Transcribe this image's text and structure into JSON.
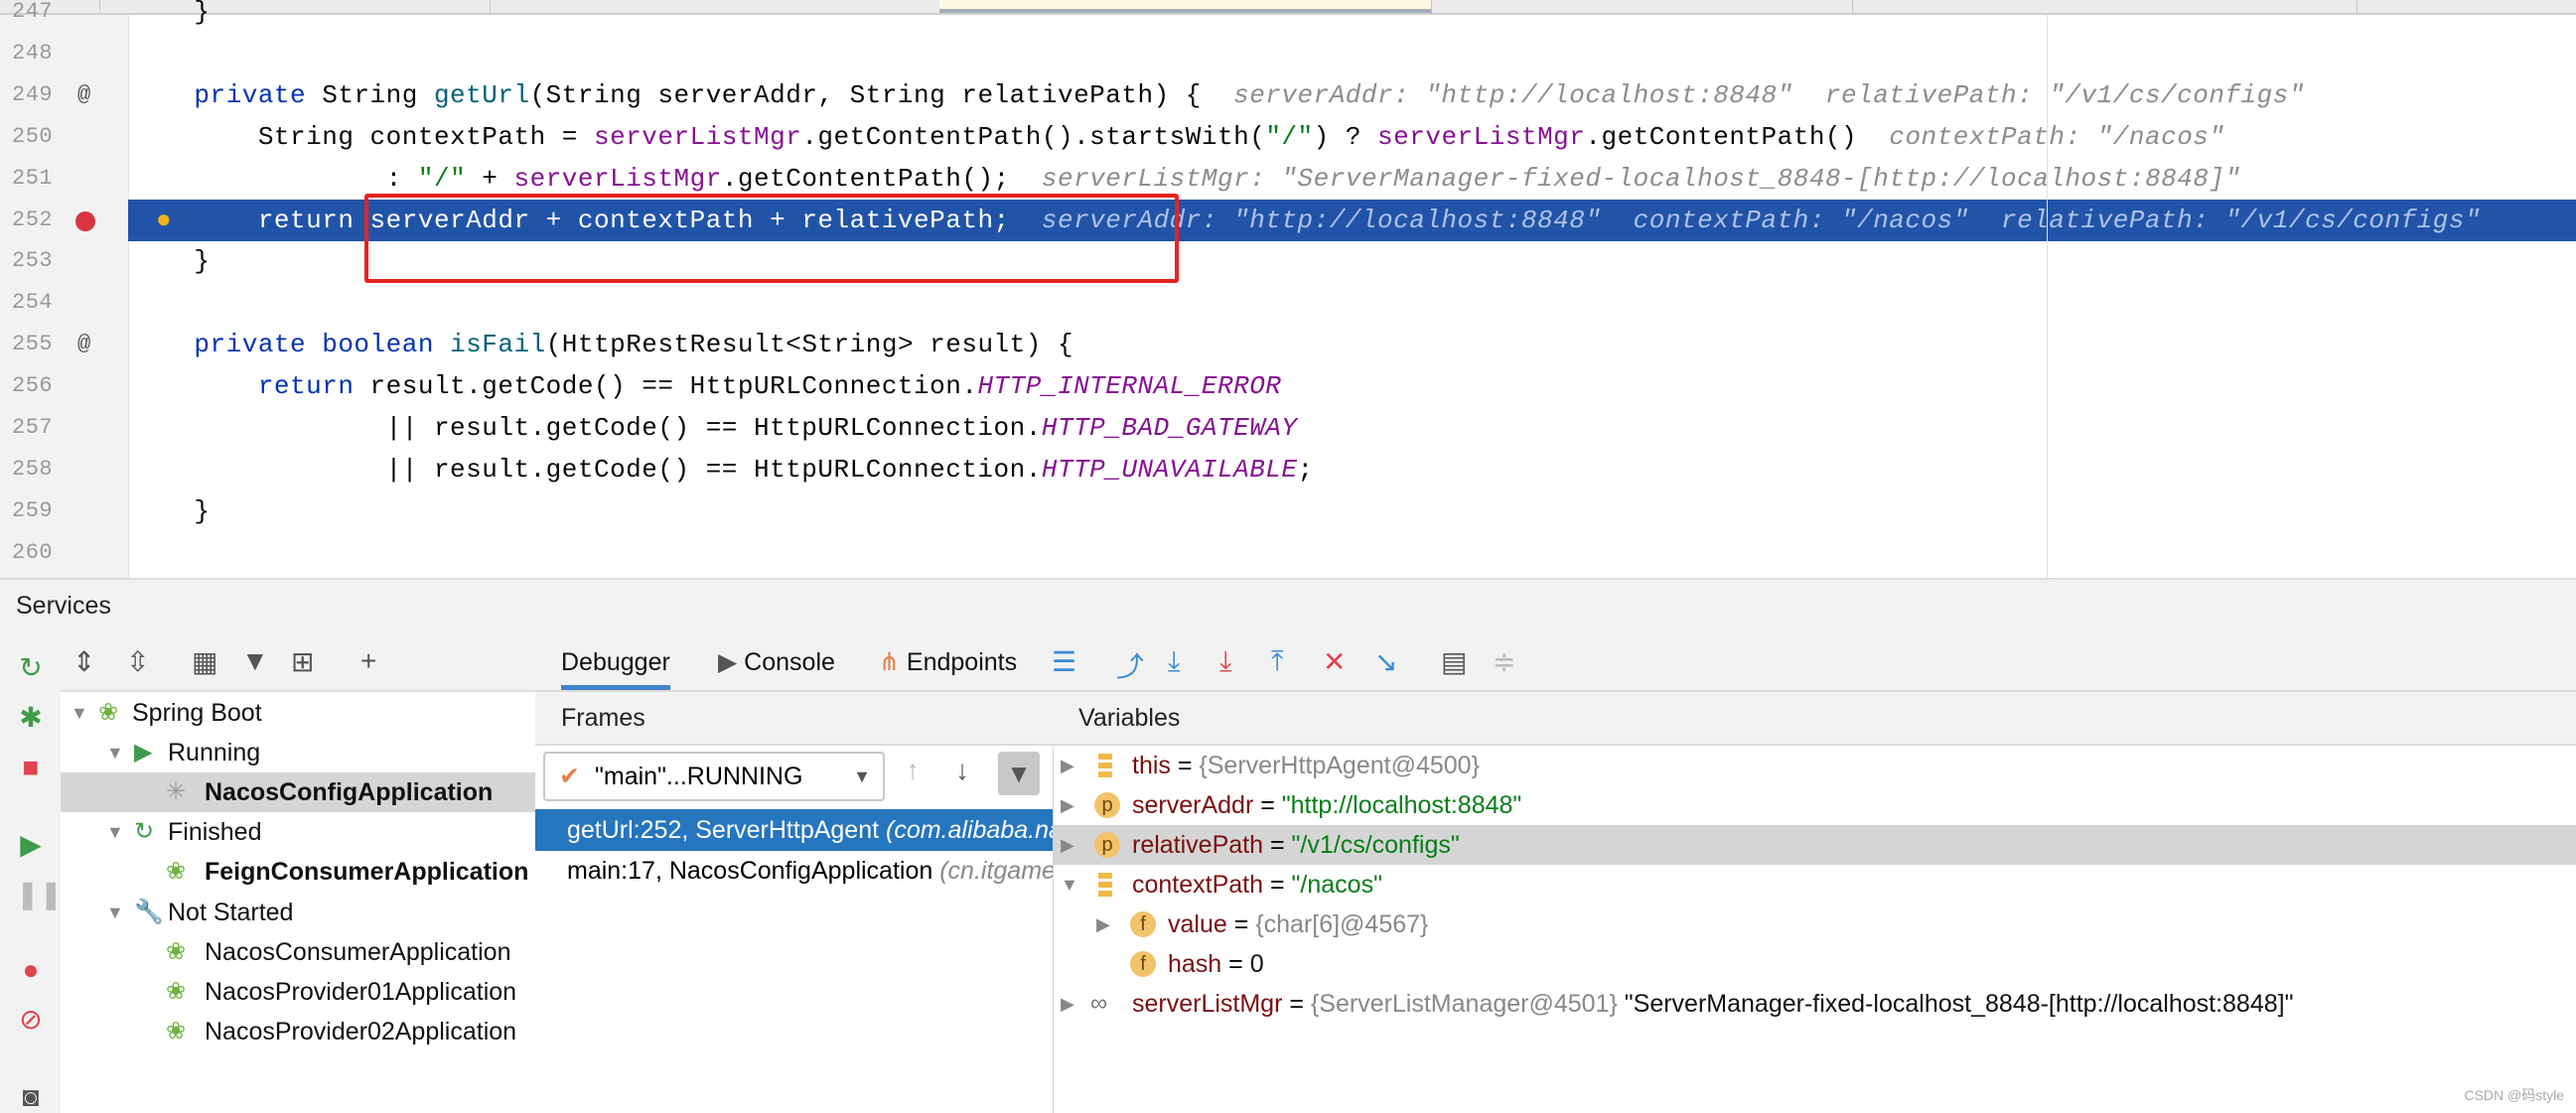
{
  "editor": {
    "lines": [
      {
        "num": "247",
        "tokens": [
          {
            "t": "    }",
            "c": "plain"
          }
        ]
      },
      {
        "num": "248",
        "tokens": []
      },
      {
        "num": "249",
        "mark": "@",
        "tokens": [
          {
            "t": "    private ",
            "c": "kw"
          },
          {
            "t": "String ",
            "c": "plain"
          },
          {
            "t": "getUrl",
            "c": "fn"
          },
          {
            "t": "(String serverAddr, String relativePath) {  ",
            "c": "plain"
          },
          {
            "t": "serverAddr: \"http://localhost:8848\"  relativePath: \"/v1/cs/configs\"",
            "c": "hint"
          }
        ]
      },
      {
        "num": "250",
        "tokens": [
          {
            "t": "        String contextPath = ",
            "c": "plain"
          },
          {
            "t": "serverListMgr",
            "c": "fld"
          },
          {
            "t": ".getContentPath().startsWith(",
            "c": "plain"
          },
          {
            "t": "\"/\"",
            "c": "str"
          },
          {
            "t": ") ? ",
            "c": "plain"
          },
          {
            "t": "serverListMgr",
            "c": "fld"
          },
          {
            "t": ".getContentPath()  ",
            "c": "plain"
          },
          {
            "t": "contextPath: \"/nacos\"",
            "c": "hint"
          }
        ]
      },
      {
        "num": "251",
        "tokens": [
          {
            "t": "                : ",
            "c": "plain"
          },
          {
            "t": "\"/\"",
            "c": "str"
          },
          {
            "t": " + ",
            "c": "plain"
          },
          {
            "t": "serverListMgr",
            "c": "fld"
          },
          {
            "t": ".getContentPath();  ",
            "c": "plain"
          },
          {
            "t": "serverListMgr: \"ServerManager-fixed-localhost_8848-[http://localhost:8848]\"",
            "c": "hint"
          }
        ]
      },
      {
        "num": "252",
        "current": true,
        "tokens": [
          {
            "t": "        return ",
            "c": "kw"
          },
          {
            "t": "serverAddr + contextPath + relativePath;  ",
            "c": "plain"
          },
          {
            "t": "serverAddr: \"http://localhost:8848\"  contextPath: \"/nacos\"  relativePath: \"/v1/cs/configs\"",
            "c": "hint"
          }
        ]
      },
      {
        "num": "253",
        "tokens": [
          {
            "t": "    }",
            "c": "plain"
          }
        ]
      },
      {
        "num": "254",
        "tokens": []
      },
      {
        "num": "255",
        "mark": "@",
        "tokens": [
          {
            "t": "    private boolean ",
            "c": "kw"
          },
          {
            "t": "isFail",
            "c": "fn"
          },
          {
            "t": "(HttpRestResult<String> result) {",
            "c": "plain"
          }
        ]
      },
      {
        "num": "256",
        "tokens": [
          {
            "t": "        return ",
            "c": "kw"
          },
          {
            "t": "result.getCode() == HttpURLConnection.",
            "c": "plain"
          },
          {
            "t": "HTTP_INTERNAL_ERROR",
            "c": "cst"
          }
        ]
      },
      {
        "num": "257",
        "tokens": [
          {
            "t": "                || result.getCode() == HttpURLConnection.",
            "c": "plain"
          },
          {
            "t": "HTTP_BAD_GATEWAY",
            "c": "cst"
          }
        ]
      },
      {
        "num": "258",
        "tokens": [
          {
            "t": "                || result.getCode() == HttpURLConnection.",
            "c": "plain"
          },
          {
            "t": "HTTP_UNAVAILABLE",
            "c": "cst"
          },
          {
            "t": ";",
            "c": "plain"
          }
        ]
      },
      {
        "num": "259",
        "tokens": [
          {
            "t": "    }",
            "c": "plain"
          }
        ]
      },
      {
        "num": "260",
        "tokens": []
      }
    ]
  },
  "services": {
    "title": "Services",
    "tree": [
      {
        "label": "Spring Boot",
        "level": 0,
        "icon": "spring-boot-icon",
        "expanded": true
      },
      {
        "label": "Running",
        "level": 1,
        "icon": "run-icon",
        "expanded": true
      },
      {
        "label": "NacosConfigApplication",
        "level": 2,
        "icon": "spinner-icon",
        "bold": true,
        "selected": true
      },
      {
        "label": "Finished",
        "level": 1,
        "icon": "rerun-icon",
        "expanded": true
      },
      {
        "label": "FeignConsumerApplication",
        "level": 2,
        "icon": "spring-boot-icon",
        "bold": true
      },
      {
        "label": "Not Started",
        "level": 1,
        "icon": "wrench-icon",
        "expanded": true
      },
      {
        "label": "NacosConsumerApplication",
        "level": 2,
        "icon": "spring-boot-icon"
      },
      {
        "label": "NacosProvider01Application",
        "level": 2,
        "icon": "spring-boot-icon"
      },
      {
        "label": "NacosProvider02Application",
        "level": 2,
        "icon": "spring-boot-icon"
      }
    ]
  },
  "debugger": {
    "tabs": [
      {
        "label": "Debugger",
        "active": true
      },
      {
        "label": "Console",
        "icon": "console-icon"
      },
      {
        "label": "Endpoints",
        "icon": "endpoints-icon"
      }
    ],
    "frames_title": "Frames",
    "thread": "\"main\"...RUNNING",
    "frames": [
      {
        "method": "getUrl:252, ServerHttpAgent",
        "pkg": "(com.alibaba.nacos.client.config.http)",
        "selected": true
      },
      {
        "method": "main:17, NacosConfigApplication",
        "pkg": "(cn.itgame)"
      }
    ],
    "variables_title": "Variables",
    "variables": [
      {
        "name": "this",
        "value": "{ServerHttpAgent@4500}",
        "kind": "obj",
        "icon": "local",
        "expander": "collapsed",
        "level": 0
      },
      {
        "name": "serverAddr",
        "value": "\"http://localhost:8848\"",
        "kind": "str",
        "icon": "p",
        "expander": "collapsed",
        "level": 0
      },
      {
        "name": "relativePath",
        "value": "\"/v1/cs/configs\"",
        "kind": "str",
        "icon": "p",
        "expander": "collapsed",
        "level": 0,
        "selected": true
      },
      {
        "name": "contextPath",
        "value": "\"/nacos\"",
        "kind": "str",
        "icon": "local",
        "expander": "expanded",
        "level": 0
      },
      {
        "name": "value",
        "value": "{char[6]@4567}",
        "kind": "obj",
        "icon": "f",
        "expander": "collapsed",
        "level": 1
      },
      {
        "name": "hash",
        "value": "0",
        "kind": "plain",
        "icon": "f",
        "level": 1
      },
      {
        "name": "serverListMgr",
        "value": "{ServerListManager@4501}",
        "extra": "\"ServerManager-fixed-localhost_8848-[http://localhost:8848]\"",
        "kind": "obj",
        "icon": "watch",
        "expander": "collapsed",
        "level": 0
      }
    ]
  },
  "watermark": "CSDN @码style",
  "colors": {
    "current_line": "#2154a8",
    "frame_selected": "#2675bf",
    "highlight_box": "#e8221f"
  }
}
